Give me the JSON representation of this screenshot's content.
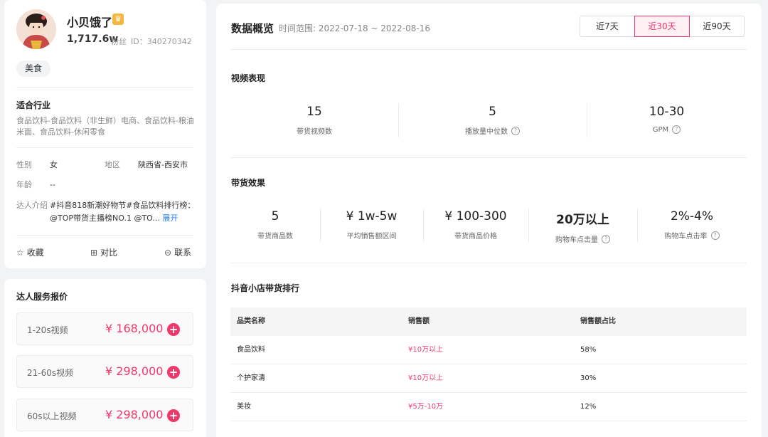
{
  "profile": {
    "name": "小贝饿了",
    "fans_count": "1,717.6w",
    "fans_label": "粉丝",
    "uid": "ID：340270342",
    "tag": "美食",
    "industry_title": "适合行业",
    "industry_text_1": "食品饮料-食品饮料（非生鲜）电商、食品饮料-粮油",
    "industry_text_2": "米面、食品饮料-休闲零食",
    "gender_label": "性别",
    "gender_value": "女",
    "region_label": "地区",
    "region_value": "陕西省-西安市",
    "age_label": "年龄",
    "age_value": "--",
    "intro_label": "达人介绍",
    "intro_text_1": "#抖音818新潮好物节#食品饮料排行榜：",
    "intro_text_2": "@TOP带货主播榜NO.1 @TO...",
    "intro_expand": "展开",
    "actions": {
      "favorite": "收藏",
      "compare": "对比",
      "contact": "联系"
    }
  },
  "pricing": {
    "title": "达人服务报价",
    "rows": [
      {
        "label": "1-20s视频",
        "price": "¥ 168,000"
      },
      {
        "label": "21-60s视频",
        "price": "¥ 298,000"
      },
      {
        "label": "60s以上视频",
        "price": "¥ 298,000"
      }
    ]
  },
  "overview": {
    "title": "数据概览",
    "range_text": "时间范围: 2022-07-18 ~ 2022-08-16",
    "ranges": [
      "近7天",
      "近30天",
      "近90天"
    ],
    "active_range": "近30天",
    "video": {
      "title": "视频表现",
      "metrics": [
        {
          "value": "15",
          "label": "带货视频数"
        },
        {
          "value": "5",
          "label": "播放量中位数"
        },
        {
          "value": "10-30",
          "label": "GPM"
        }
      ]
    },
    "sales": {
      "title": "带货效果",
      "metrics": [
        {
          "value": "5",
          "label": "带货商品数"
        },
        {
          "value": "¥ 1w-5w",
          "label": "平均销售额区间"
        },
        {
          "value": "¥ 100-300",
          "label": "带货商品价格"
        },
        {
          "value": "20万以上",
          "label": "购物车点击量"
        },
        {
          "value": "2%-4%",
          "label": "购物车点击率"
        }
      ]
    },
    "ranking": {
      "title": "抖音小店带货排行",
      "headers": [
        "品类名称",
        "销售额",
        "销售额占比"
      ],
      "rows": [
        [
          "食品饮料",
          "¥10万以上",
          "58%"
        ],
        [
          "个护家清",
          "¥10万以上",
          "30%"
        ],
        [
          "美妆",
          "¥5万-10万",
          "12%"
        ]
      ]
    }
  },
  "colors": {
    "accent": "#f0386b",
    "link": "#2a7df6",
    "vip": "#f5b740"
  }
}
